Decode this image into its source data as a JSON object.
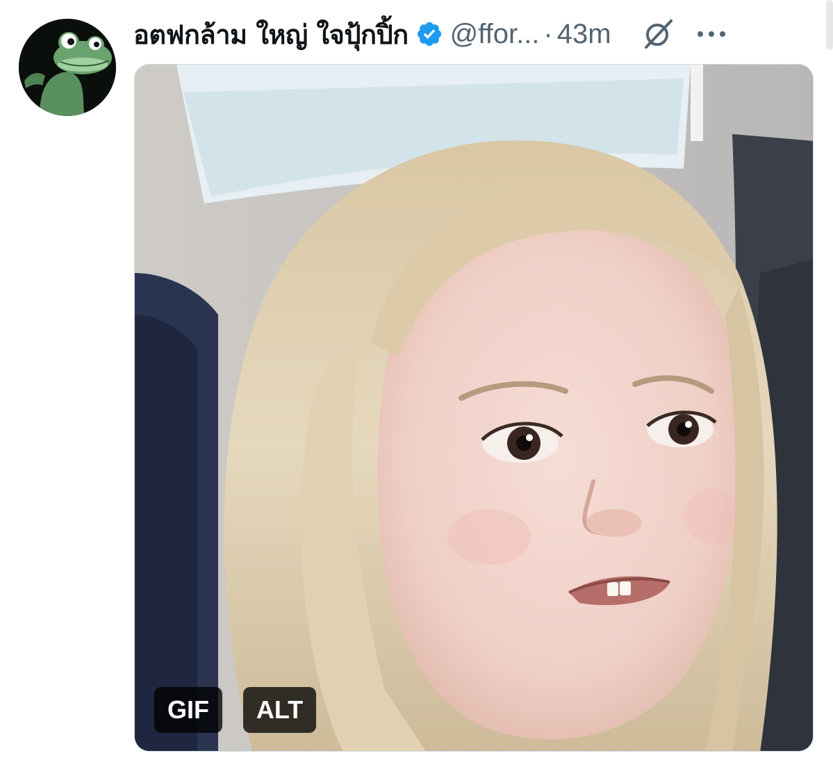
{
  "tweet": {
    "display_name": "อตฟกล้าม ใหญ่ ใจปุ้กปิ้ก",
    "handle": "@ffor...",
    "separator": "·",
    "time": "43m",
    "verified": true,
    "icons": {
      "avatar": "frog-avatar",
      "verified": "verified-badge-icon",
      "grok": "grok-icon",
      "more": "more-options-icon"
    },
    "media": {
      "type": "gif",
      "gif_label": "GIF",
      "alt_label": "ALT"
    },
    "colors": {
      "accent": "#1d9bf0",
      "text_primary": "#0f1419",
      "text_secondary": "#536471"
    }
  }
}
